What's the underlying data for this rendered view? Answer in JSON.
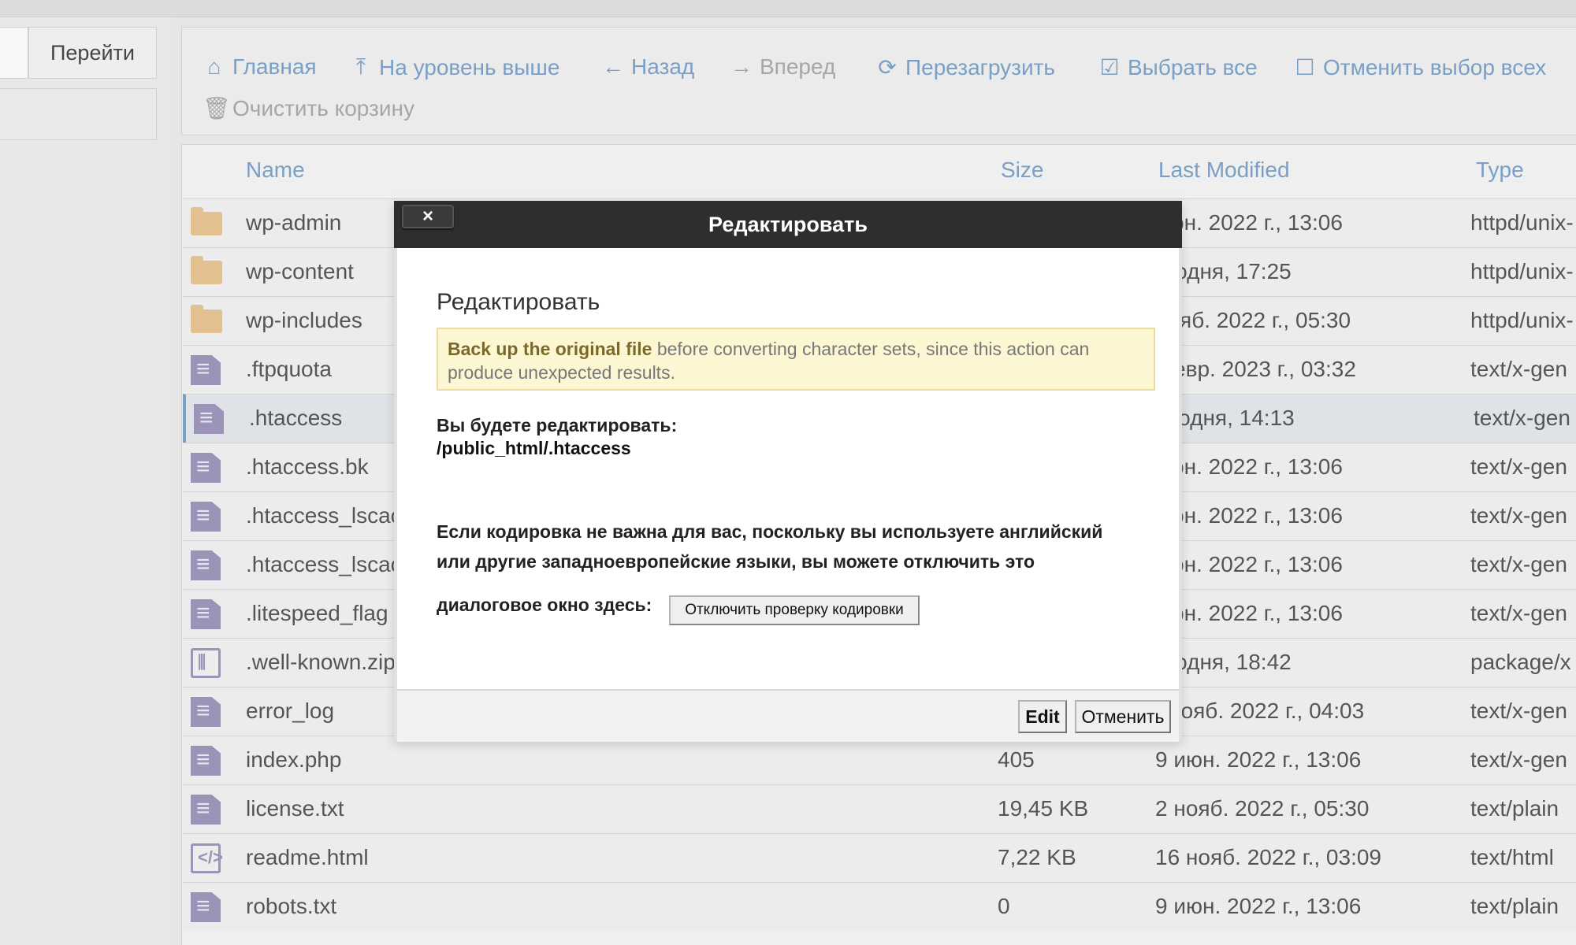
{
  "navigation": {
    "goto_button": "Перейти"
  },
  "toolbar": {
    "home": "Главная",
    "up": "На уровень выше",
    "back": "Назад",
    "forward": "Вперед",
    "reload": "Перезагрузить",
    "select_all": "Выбрать все",
    "deselect_all": "Отменить выбор всех",
    "empty_trash": "Очистить корзину"
  },
  "table": {
    "headers": {
      "name": "Name",
      "size": "Size",
      "last_modified": "Last Modified",
      "type": "Type"
    },
    "rows": [
      {
        "icon": "folder-icon",
        "name": "wp-admin",
        "size": "",
        "date": "июн. 2022 г., 13:06",
        "type": "httpd/unix-"
      },
      {
        "icon": "folder-icon",
        "name": "wp-content",
        "size": "",
        "date": "егодня, 17:25",
        "type": "httpd/unix-"
      },
      {
        "icon": "folder-icon",
        "name": "wp-includes",
        "size": "",
        "date": "нояб. 2022 г., 05:30",
        "type": "httpd/unix-"
      },
      {
        "icon": "file-text-icon",
        "name": ".ftpquota",
        "size": "",
        "date": "февр. 2023 г., 03:32",
        "type": "text/x-gen"
      },
      {
        "icon": "file-text-icon",
        "name": ".htaccess",
        "size": "",
        "date": "егодня, 14:13",
        "type": "text/x-gen"
      },
      {
        "icon": "file-text-icon",
        "name": ".htaccess.bk",
        "size": "",
        "date": "июн. 2022 г., 13:06",
        "type": "text/x-gen"
      },
      {
        "icon": "file-text-icon",
        "name": ".htaccess_lscac",
        "size": "",
        "date": "июн. 2022 г., 13:06",
        "type": "text/x-gen"
      },
      {
        "icon": "file-text-icon",
        "name": ".htaccess_lscac",
        "size": "",
        "date": "июн. 2022 г., 13:06",
        "type": "text/x-gen"
      },
      {
        "icon": "file-text-icon",
        "name": ".litespeed_flag",
        "size": "",
        "date": "июн. 2022 г., 13:06",
        "type": "text/x-gen"
      },
      {
        "icon": "file-zip-icon",
        "name": ".well-known.zip",
        "size": "",
        "date": "егодня, 18:42",
        "type": "package/x"
      },
      {
        "icon": "file-text-icon",
        "name": "error_log",
        "size": "",
        "date": ") нояб. 2022 г., 04:03",
        "type": "text/x-gen"
      },
      {
        "icon": "file-text-icon",
        "name": "index.php",
        "size": "405",
        "date": "9 июн. 2022 г., 13:06",
        "type": "text/x-gen"
      },
      {
        "icon": "file-text-icon",
        "name": "license.txt",
        "size": "19,45 KB",
        "date": "2 нояб. 2022 г., 05:30",
        "type": "text/plain"
      },
      {
        "icon": "file-code-icon",
        "name": "readme.html",
        "size": "7,22 KB",
        "date": "16 нояб. 2022 г., 03:09",
        "type": "text/html"
      },
      {
        "icon": "file-text-icon",
        "name": "robots.txt",
        "size": "0",
        "date": "9 июн. 2022 г., 13:06",
        "type": "text/plain"
      }
    ]
  },
  "modal": {
    "header_title": "Редактировать",
    "close_label": "×",
    "title": "Редактировать",
    "warning_bold": "Back up the original file",
    "warning_text": " before converting character sets, since this action can produce unexpected results.",
    "edit_label": "Вы будете редактировать:",
    "edit_path": "/public_html/.htaccess",
    "encoding_note_line1": "Если кодировка не важна для вас, поскольку вы используете английский",
    "encoding_note_line2": "или другие западноевропейские языки, вы можете отключить это",
    "encoding_note_line3": "диалоговое окно здесь:",
    "disable_check_button": "Отключить проверку кодировки",
    "edit_button": "Edit",
    "cancel_button": "Отменить"
  }
}
